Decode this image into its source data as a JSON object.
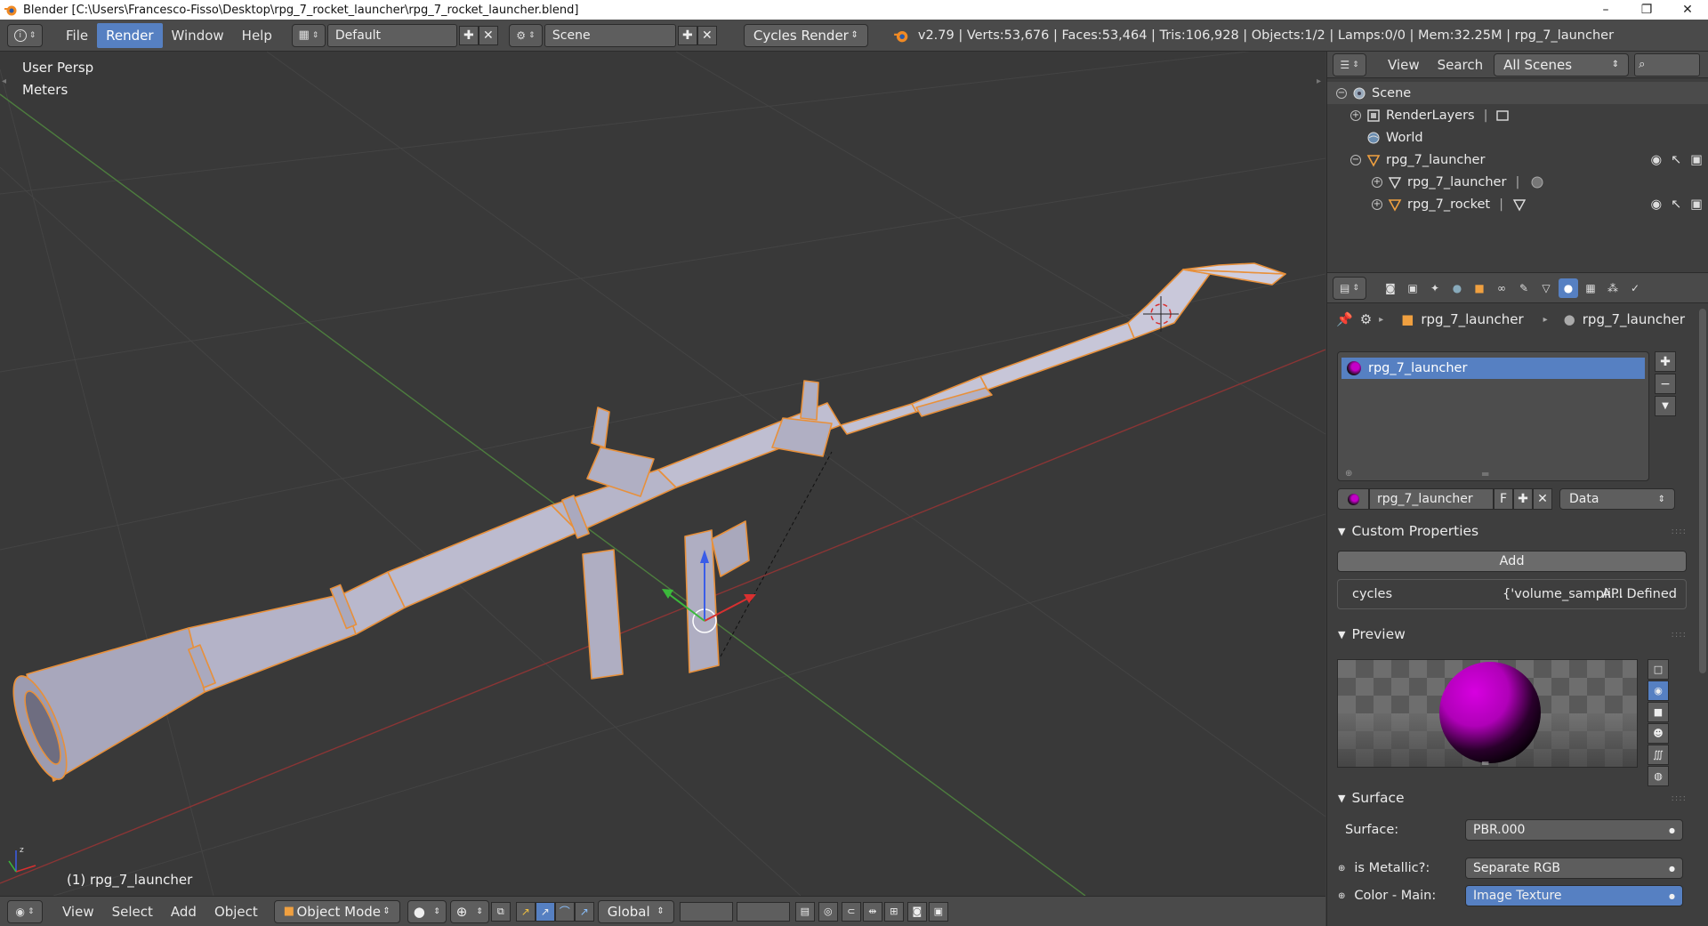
{
  "window": {
    "title": "Blender [C:\\Users\\Francesco-Fisso\\Desktop\\rpg_7_rocket_launcher\\rpg_7_rocket_launcher.blend]",
    "controls": [
      "–",
      "❐",
      "✕"
    ]
  },
  "info_header": {
    "menus": [
      "File",
      "Render",
      "Window",
      "Help"
    ],
    "active_menu": "Render",
    "screen_layout": "Default",
    "scene": "Scene",
    "render_engine": "Cycles Render",
    "stats": "v2.79 | Verts:53,676 | Faces:53,464 | Tris:106,928 | Objects:1/2 | Lamps:0/0 | Mem:32.25M | rpg_7_launcher"
  },
  "viewport": {
    "view_name": "User Persp",
    "units": "Meters",
    "active_object": "(1) rpg_7_launcher",
    "footer": {
      "menus": [
        "View",
        "Select",
        "Add",
        "Object"
      ],
      "mode": "Object Mode",
      "orientation": "Global"
    }
  },
  "outliner": {
    "header": {
      "view": "View",
      "search": "Search",
      "display": "All Scenes"
    },
    "tree": [
      {
        "label": "Scene",
        "level": 0,
        "icon": "scene-icon"
      },
      {
        "label": "RenderLayers",
        "level": 1,
        "icon": "render-layers-icon"
      },
      {
        "label": "World",
        "level": 1,
        "icon": "world-icon"
      },
      {
        "label": "rpg_7_launcher",
        "level": 1,
        "icon": "mesh-object-icon"
      },
      {
        "label": "rpg_7_launcher",
        "level": 2,
        "icon": "mesh-data-icon"
      },
      {
        "label": "rpg_7_rocket",
        "level": 2,
        "icon": "mesh-object-icon"
      }
    ]
  },
  "properties": {
    "breadcrumb": [
      "rpg_7_launcher",
      "rpg_7_launcher"
    ],
    "material_slots": [
      "rpg_7_launcher"
    ],
    "material_name": "rpg_7_launcher",
    "fake_user": "F",
    "link": "Data",
    "custom_properties": {
      "title": "Custom Properties",
      "add_label": "Add",
      "prop_name": "cycles",
      "prop_value": "{'volume_sampli...",
      "prop_type": "API Defined"
    },
    "preview": {
      "title": "Preview"
    },
    "surface": {
      "title": "Surface",
      "rows": [
        {
          "label": "Surface:",
          "value": "PBR.000"
        },
        {
          "label": "is Metallic?:",
          "value": "Separate RGB"
        },
        {
          "label": "Color - Main:",
          "value": "Image Texture"
        }
      ]
    }
  },
  "colors": {
    "accent": "#5680c2",
    "viewport_bg": "#393939",
    "panel_bg": "#3e3e3e",
    "header_bg": "#4a4a4a",
    "model": "#b9b8cc",
    "selection_outline": "#e8903a",
    "material_preview": "#c400c8"
  }
}
